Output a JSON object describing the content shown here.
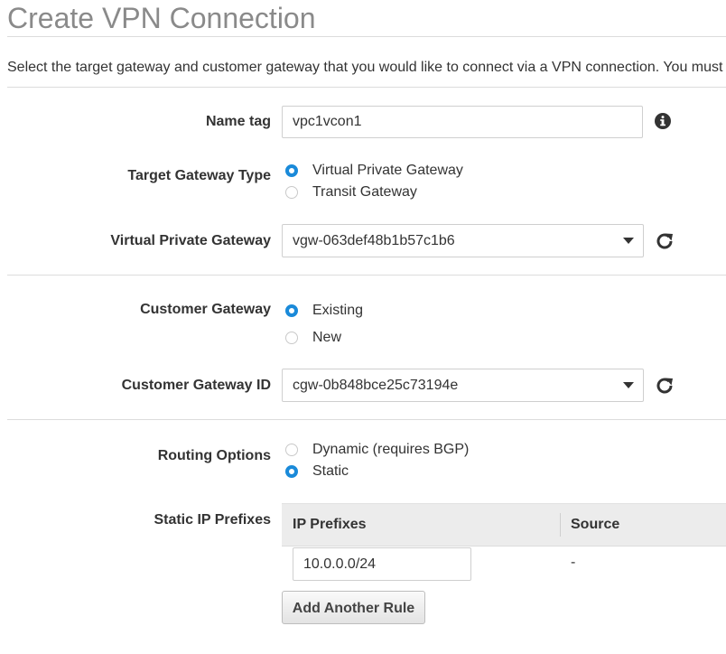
{
  "page": {
    "title": "Create VPN Connection",
    "intro": "Select the target gateway and customer gateway that you would like to connect via a VPN connection. You must have entered the target gateway information already."
  },
  "form": {
    "name_tag": {
      "label": "Name tag",
      "value": "vpc1vcon1",
      "info_icon": "info-circle-icon"
    },
    "target_gateway_type": {
      "label": "Target Gateway Type",
      "options": [
        {
          "label": "Virtual Private Gateway",
          "selected": true
        },
        {
          "label": "Transit Gateway",
          "selected": false
        }
      ]
    },
    "virtual_private_gateway": {
      "label": "Virtual Private Gateway",
      "value": "vgw-063def48b1b57c1b6",
      "refresh_icon": "refresh-icon"
    },
    "customer_gateway": {
      "label": "Customer Gateway",
      "options": [
        {
          "label": "Existing",
          "selected": true
        },
        {
          "label": "New",
          "selected": false
        }
      ]
    },
    "customer_gateway_id": {
      "label": "Customer Gateway ID",
      "value": "cgw-0b848bce25c73194e",
      "refresh_icon": "refresh-icon"
    },
    "routing_options": {
      "label": "Routing Options",
      "options": [
        {
          "label": "Dynamic (requires BGP)",
          "selected": false
        },
        {
          "label": "Static",
          "selected": true
        }
      ]
    },
    "static_ip_prefixes": {
      "label": "Static IP Prefixes",
      "columns": [
        "IP Prefixes",
        "Source"
      ],
      "rows": [
        {
          "ip_prefix": "10.0.0.0/24",
          "source": "-"
        }
      ],
      "add_button": "Add Another Rule"
    }
  },
  "colors": {
    "radio_selected": "#1a8ad9",
    "title": "#8a8a8a"
  }
}
